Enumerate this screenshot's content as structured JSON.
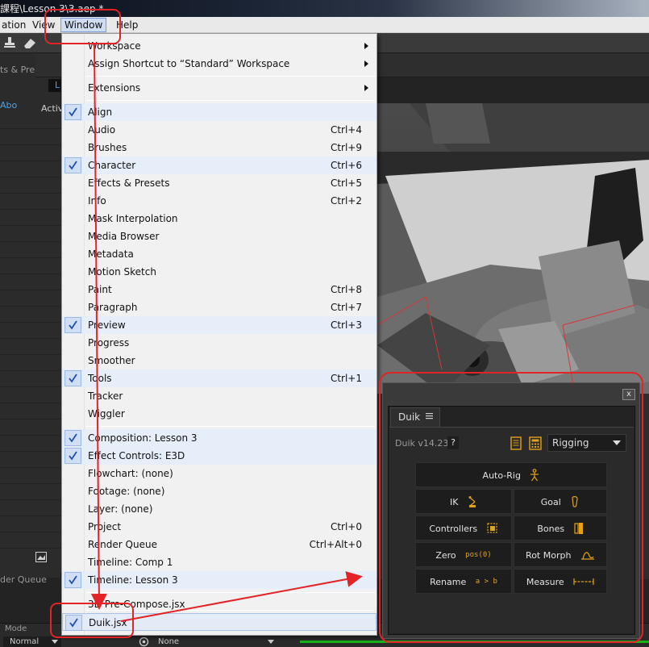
{
  "window": {
    "title": "課程\\Lesson 3\\3.aep *"
  },
  "menubar": {
    "items": [
      "ation",
      "View",
      "Window",
      "Help"
    ]
  },
  "left_panel": {
    "tab_label": "ts & Pre",
    "about_label": "Abo"
  },
  "viewer": {
    "active_label": "Activ",
    "subtab": "L"
  },
  "bottom": {
    "render_queue_tab": "der Queue",
    "mode_label": "Mode",
    "mode_value": "Normal",
    "none_value": "None"
  },
  "window_menu": {
    "items": [
      {
        "label": "Workspace",
        "shortcut": "",
        "submenu": true,
        "checked": false
      },
      {
        "label": "Assign Shortcut to  “Standard”  Workspace",
        "shortcut": "",
        "submenu": true,
        "checked": false
      },
      {
        "label": "Extensions",
        "shortcut": "",
        "submenu": true,
        "checked": false
      },
      {
        "label": "Align",
        "shortcut": "",
        "submenu": false,
        "checked": true
      },
      {
        "label": "Audio",
        "shortcut": "Ctrl+4",
        "submenu": false,
        "checked": false
      },
      {
        "label": "Brushes",
        "shortcut": "Ctrl+9",
        "submenu": false,
        "checked": false
      },
      {
        "label": "Character",
        "shortcut": "Ctrl+6",
        "submenu": false,
        "checked": true
      },
      {
        "label": "Effects & Presets",
        "shortcut": "Ctrl+5",
        "submenu": false,
        "checked": false
      },
      {
        "label": "Info",
        "shortcut": "Ctrl+2",
        "submenu": false,
        "checked": false
      },
      {
        "label": "Mask Interpolation",
        "shortcut": "",
        "submenu": false,
        "checked": false
      },
      {
        "label": "Media Browser",
        "shortcut": "",
        "submenu": false,
        "checked": false
      },
      {
        "label": "Metadata",
        "shortcut": "",
        "submenu": false,
        "checked": false
      },
      {
        "label": "Motion Sketch",
        "shortcut": "",
        "submenu": false,
        "checked": false
      },
      {
        "label": "Paint",
        "shortcut": "Ctrl+8",
        "submenu": false,
        "checked": false
      },
      {
        "label": "Paragraph",
        "shortcut": "Ctrl+7",
        "submenu": false,
        "checked": false
      },
      {
        "label": "Preview",
        "shortcut": "Ctrl+3",
        "submenu": false,
        "checked": true
      },
      {
        "label": "Progress",
        "shortcut": "",
        "submenu": false,
        "checked": false
      },
      {
        "label": "Smoother",
        "shortcut": "",
        "submenu": false,
        "checked": false
      },
      {
        "label": "Tools",
        "shortcut": "Ctrl+1",
        "submenu": false,
        "checked": true
      },
      {
        "label": "Tracker",
        "shortcut": "",
        "submenu": false,
        "checked": false
      },
      {
        "label": "Wiggler",
        "shortcut": "",
        "submenu": false,
        "checked": false
      },
      {
        "label": "Composition: Lesson 3",
        "shortcut": "",
        "submenu": false,
        "checked": true
      },
      {
        "label": "Effect Controls: E3D",
        "shortcut": "",
        "submenu": false,
        "checked": true
      },
      {
        "label": "Flowchart: (none)",
        "shortcut": "",
        "submenu": false,
        "checked": false
      },
      {
        "label": "Footage: (none)",
        "shortcut": "",
        "submenu": false,
        "checked": false
      },
      {
        "label": "Layer: (none)",
        "shortcut": "",
        "submenu": false,
        "checked": false
      },
      {
        "label": "Project",
        "shortcut": "Ctrl+0",
        "submenu": false,
        "checked": false
      },
      {
        "label": "Render Queue",
        "shortcut": "Ctrl+Alt+0",
        "submenu": false,
        "checked": false
      },
      {
        "label": "Timeline: Comp 1",
        "shortcut": "",
        "submenu": false,
        "checked": false
      },
      {
        "label": "Timeline: Lesson 3",
        "shortcut": "",
        "submenu": false,
        "checked": true
      },
      {
        "label": "3D Pre-Compose.jsx",
        "shortcut": "",
        "submenu": false,
        "checked": false
      },
      {
        "label": "Duik.jsx",
        "shortcut": "",
        "submenu": false,
        "checked": true
      }
    ]
  },
  "duik_panel": {
    "close_label": "x",
    "tab_label": "Duik",
    "tab_menu_icon": "hamburger-icon",
    "version": "Duik v14.23",
    "help_label": "?",
    "mode_value": "Rigging",
    "buttons": {
      "autorig": {
        "label": "Auto-Rig",
        "icon": "person-icon"
      },
      "ik": {
        "label": "IK",
        "icon": "ik-chain-icon"
      },
      "goal": {
        "label": "Goal",
        "icon": "foot-icon"
      },
      "controllers": {
        "label": "Controllers",
        "icon": "controller-icon"
      },
      "bones": {
        "label": "Bones",
        "icon": "bones-icon"
      },
      "zero": {
        "label": "Zero",
        "icon_text": "pos(0)"
      },
      "rotmorph": {
        "label": "Rot Morph",
        "icon": "rot-morph-icon"
      },
      "rename": {
        "label": "Rename",
        "icon_text": "a > b"
      },
      "measure": {
        "label": "Measure",
        "icon": "measure-icon"
      }
    }
  },
  "colors": {
    "annotation_red": "#e22327",
    "duik_accent": "#e1a21a",
    "check_blue": "#1f4ea8",
    "timeline_green": "#19b219"
  }
}
